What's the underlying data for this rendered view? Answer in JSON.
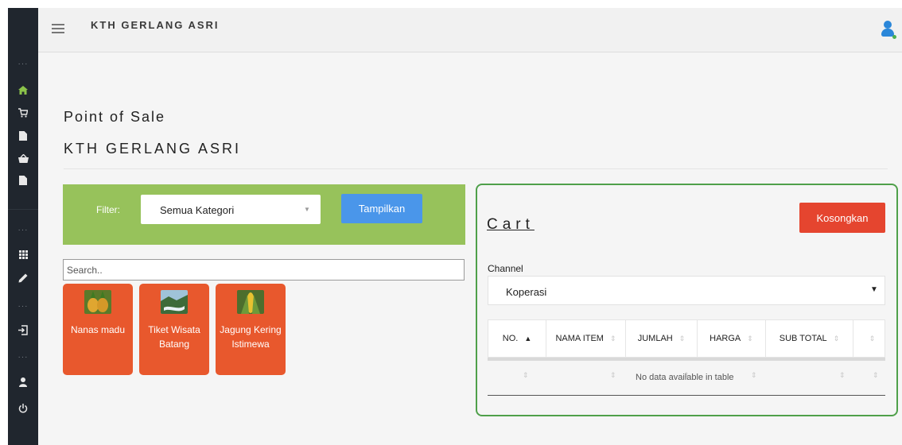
{
  "app": {
    "brand": "KTH GERLANG ASRI"
  },
  "sidebar": {
    "icons": [
      "more-dots",
      "home-icon",
      "cart-icon",
      "document-icon",
      "basket-icon",
      "document-icon",
      "more-dots",
      "grid-icon",
      "pencil-icon",
      "more-dots",
      "logout-icon",
      "more-dots",
      "user-icon",
      "power-icon"
    ],
    "active_color": "#8bc34a"
  },
  "page": {
    "title": "Point of Sale",
    "subtitle": "KTH GERLANG ASRI"
  },
  "filter": {
    "label": "Filter:",
    "selected": "Semua Kategori",
    "button": "Tampilkan",
    "bg_color": "#97c25b",
    "button_color": "#4a96ea"
  },
  "search": {
    "placeholder": "Search.."
  },
  "products": [
    {
      "name": "Nanas madu",
      "icon": "pineapple-image"
    },
    {
      "name": "Tiket Wisata Batang",
      "icon": "landscape-image"
    },
    {
      "name": "Jagung Kering Istimewa",
      "icon": "corn-image"
    }
  ],
  "cart": {
    "title": "Cart",
    "clear_button": "Kosongkan",
    "channel_label": "Channel",
    "channel_selected": "Koperasi",
    "columns": [
      "NO.",
      "NAMA ITEM",
      "JUMLAH",
      "HARGA",
      "SUB TOTAL",
      ""
    ],
    "empty_message": "No data available in table",
    "border_color": "#4fa04a",
    "button_color": "#e5452f"
  },
  "colors": {
    "card": "#e8582d",
    "sidebar": "#20262e",
    "avatar": "#2b87d9"
  }
}
